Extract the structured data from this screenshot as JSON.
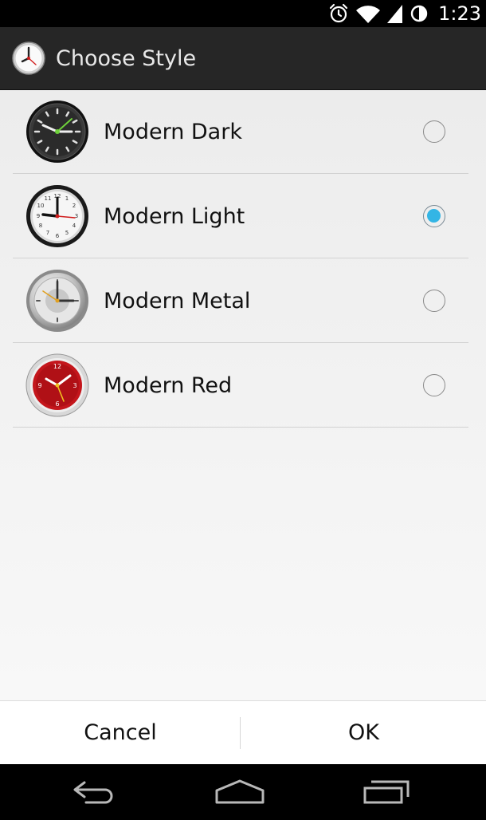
{
  "status_bar": {
    "time": "1:23",
    "icons": [
      "alarm-icon",
      "wifi-icon",
      "signal-icon",
      "battery-icon"
    ]
  },
  "dialog": {
    "title": "Choose Style",
    "icon": "clock-icon",
    "options": [
      {
        "label": "Modern Dark",
        "selected": false,
        "icon": "dark-clock-icon",
        "face_color": "#2b2b2b"
      },
      {
        "label": "Modern Light",
        "selected": true,
        "icon": "light-clock-icon",
        "face_color": "#f4f4f4"
      },
      {
        "label": "Modern Metal",
        "selected": false,
        "icon": "metal-clock-icon",
        "face_color": "#c9c9c9"
      },
      {
        "label": "Modern Red",
        "selected": false,
        "icon": "red-clock-icon",
        "face_color": "#c4161c"
      }
    ],
    "buttons": {
      "cancel": "Cancel",
      "ok": "OK"
    }
  },
  "navigation": {
    "icons": [
      "back-icon",
      "home-icon",
      "recent-apps-icon"
    ]
  },
  "colors": {
    "accent": "#33b5e5",
    "title_bar": "#262626",
    "status_bar": "#000000"
  }
}
